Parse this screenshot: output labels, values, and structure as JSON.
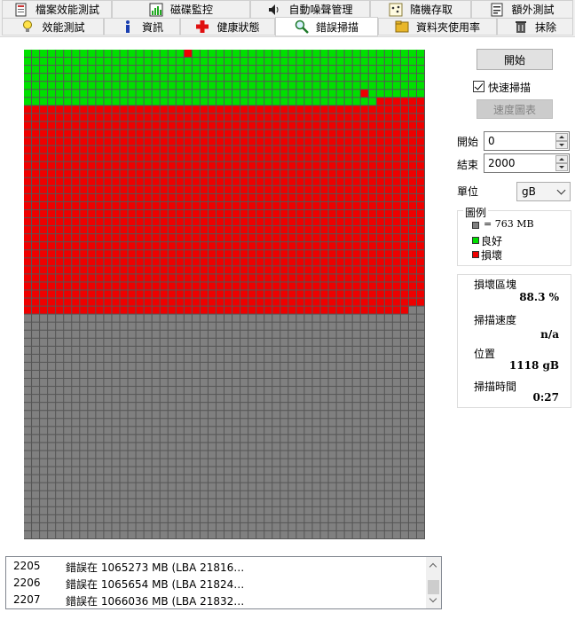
{
  "tabs_row1": [
    {
      "label": "檔案效能測試",
      "icon": "file-benchmark-icon"
    },
    {
      "label": "磁碟監控",
      "icon": "disk-monitor-icon"
    },
    {
      "label": "自動噪聲管理",
      "icon": "speaker-icon"
    },
    {
      "label": "隨機存取",
      "icon": "random-access-icon"
    },
    {
      "label": "額外測試",
      "icon": "extra-tests-icon"
    }
  ],
  "tabs_row2": [
    {
      "label": "效能測試",
      "icon": "lightbulb-icon"
    },
    {
      "label": "資訊",
      "icon": "info-icon"
    },
    {
      "label": "健康狀態",
      "icon": "health-cross-icon"
    },
    {
      "label": "錯誤掃描",
      "icon": "magnifier-icon",
      "active": true
    },
    {
      "label": "資料夾使用率",
      "icon": "folder-icon"
    },
    {
      "label": "抹除",
      "icon": "trash-icon"
    }
  ],
  "controls": {
    "start_button": "開始",
    "quick_scan_label": "快速掃描",
    "quick_scan_checked": true,
    "speed_chart_button": "速度圖表",
    "start_label": "開始",
    "start_value": "0",
    "end_label": "結束",
    "end_value": "2000",
    "unit_label": "單位",
    "unit_value": "gB"
  },
  "legend": {
    "title": "圖例",
    "block_size": "= 763 MB",
    "good": "良好",
    "damaged": "損壞",
    "colors": {
      "unscanned": "#808080",
      "good": "#00e000",
      "damaged": "#ee0000"
    }
  },
  "stats": {
    "damaged_blocks_label": "損壞區塊",
    "damaged_blocks_value": "88.3 %",
    "scan_speed_label": "掃描速度",
    "scan_speed_value": "n/a",
    "position_label": "位置",
    "position_value": "1118 gB",
    "scan_time_label": "掃描時間",
    "scan_time_value": "0:27"
  },
  "block_map": {
    "columns": 50,
    "rows": 61,
    "good_rows_full": 6,
    "good_extra_row7_count": 44,
    "red_blocks_in_green_zone": [
      {
        "row": 1,
        "col": 21
      },
      {
        "row": 6,
        "col": 43
      }
    ],
    "damaged_until_row": 33,
    "damaged_last_row_count": 48
  },
  "log": [
    {
      "n": "2205",
      "text": "錯誤在 1065273 MB (LBA 21816…"
    },
    {
      "n": "2206",
      "text": "錯誤在 1065654 MB (LBA 21824…"
    },
    {
      "n": "2207",
      "text": "錯誤在 1066036 MB (LBA 21832…"
    }
  ]
}
